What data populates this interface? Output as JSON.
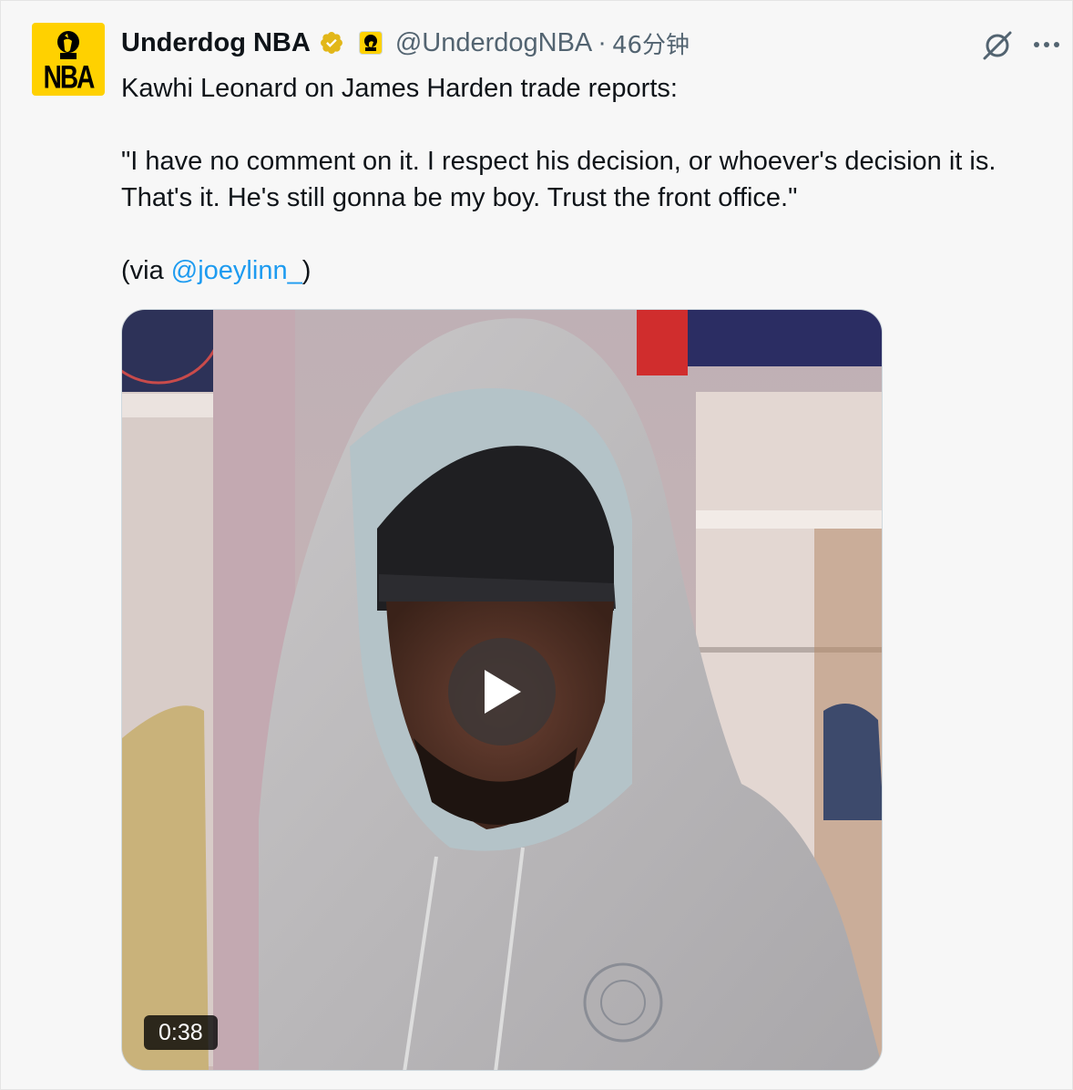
{
  "tweet": {
    "display_name": "Underdog NBA",
    "handle": "@UnderdogNBA",
    "separator": "·",
    "time": "46分钟",
    "avatar_text": "NBA",
    "text_lines": [
      "Kawhi Leonard on James Harden trade reports:",
      "\"I have no comment on it. I respect his decision, or whoever's decision it is.",
      "That's it. He's still gonna be my boy. Trust the front office.\""
    ],
    "via_prefix": "(via ",
    "via_mention": "@joeylinn_",
    "via_suffix": ")",
    "video_duration": "0:38"
  },
  "icons": {
    "verified": "verified-gold-badge-icon",
    "affiliate": "underdog-affiliate-badge-icon",
    "grok": "grok-icon",
    "more": "more-options-icon",
    "play": "play-icon"
  },
  "colors": {
    "avatar_bg": "#ffd100",
    "verified_gold": "#e2b719",
    "link": "#1d9bf0",
    "muted": "#536471",
    "text": "#0f1419"
  }
}
